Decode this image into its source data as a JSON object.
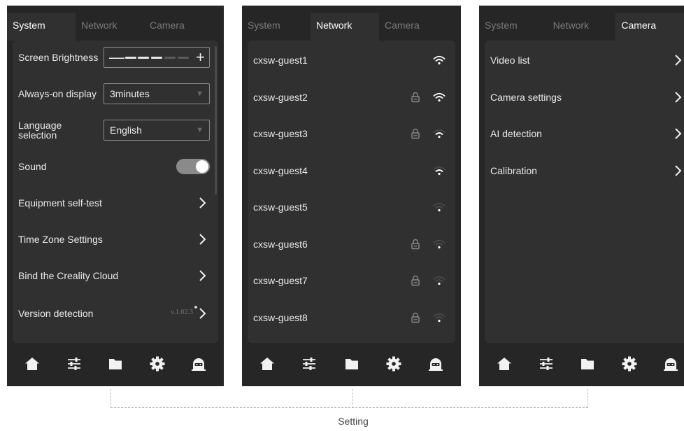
{
  "tabs": [
    "System",
    "Network",
    "Camera"
  ],
  "system": {
    "brightness": {
      "label": "Screen Brightness",
      "minus": "—",
      "plus": "+",
      "level": 3,
      "max_level": 5
    },
    "always_on": {
      "label": "Always-on display",
      "value": "3minutes",
      "caret": "▼"
    },
    "language": {
      "label_line1": "Language",
      "label_line2": "selection",
      "value": "English",
      "caret": "▼"
    },
    "sound": {
      "label": "Sound",
      "on": true
    },
    "self_test": {
      "label": "Equipment self-test"
    },
    "time_zone": {
      "label": "Time Zone Settings"
    },
    "bind_cloud": {
      "label": "Bind the Creality Cloud"
    },
    "version": {
      "label": "Version detection",
      "value": "v.1.02.3"
    }
  },
  "network": {
    "items": [
      {
        "ssid": "cxsw-guest1",
        "locked": false,
        "signal": 3
      },
      {
        "ssid": "cxsw-guest2",
        "locked": true,
        "signal": 3
      },
      {
        "ssid": "cxsw-guest3",
        "locked": true,
        "signal": 2
      },
      {
        "ssid": "cxsw-guest4",
        "locked": false,
        "signal": 2
      },
      {
        "ssid": "cxsw-guest5",
        "locked": false,
        "signal": 1
      },
      {
        "ssid": "cxsw-guest6",
        "locked": true,
        "signal": 1
      },
      {
        "ssid": "cxsw-guest7",
        "locked": true,
        "signal": 1
      },
      {
        "ssid": "cxsw-guest8",
        "locked": true,
        "signal": 1
      }
    ]
  },
  "camera": {
    "items": [
      "Video list",
      "Camera settings",
      "AI detection",
      "Calibration"
    ]
  },
  "bottom_nav": [
    "home-icon",
    "sliders-icon",
    "folder-icon",
    "gear-icon",
    "robot-icon"
  ],
  "caption": "Setting",
  "colors": {
    "background": "#262626",
    "panel": "#303030",
    "text": "#eaeaea",
    "muted": "#7a7a7a"
  }
}
